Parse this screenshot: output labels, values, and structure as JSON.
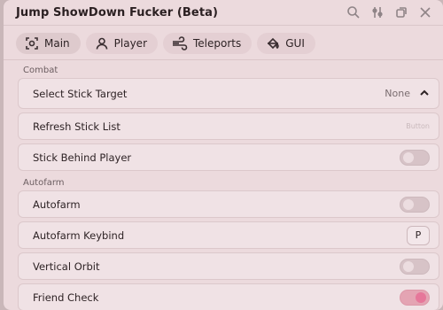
{
  "window": {
    "title": "Jump ShowDown Fucker (Beta)"
  },
  "titlebar_icons": [
    "search-icon",
    "settings-sliders-icon",
    "minimize-icon",
    "close-icon"
  ],
  "tabs": [
    {
      "label": "Main",
      "icon": "target-icon",
      "active": true
    },
    {
      "label": "Player",
      "icon": "user-icon"
    },
    {
      "label": "Teleports",
      "icon": "wind-icon"
    },
    {
      "label": "GUI",
      "icon": "paint-bucket-icon"
    }
  ],
  "sections": {
    "combat": {
      "title": "Combat",
      "select_target": {
        "label": "Select Stick Target",
        "value": "None"
      },
      "refresh": {
        "label": "Refresh Stick List",
        "hint": "Button"
      },
      "behind": {
        "label": "Stick Behind Player",
        "on": false
      }
    },
    "autofarm": {
      "title": "Autofarm",
      "autofarm": {
        "label": "Autofarm",
        "on": false
      },
      "keybind": {
        "label": "Autofarm Keybind",
        "key": "P"
      },
      "orbit": {
        "label": "Vertical Orbit",
        "on": false
      },
      "friend": {
        "label": "Friend Check",
        "on": true
      }
    }
  },
  "colors": {
    "accent": "#e6779a",
    "background": "#ecdadd"
  }
}
